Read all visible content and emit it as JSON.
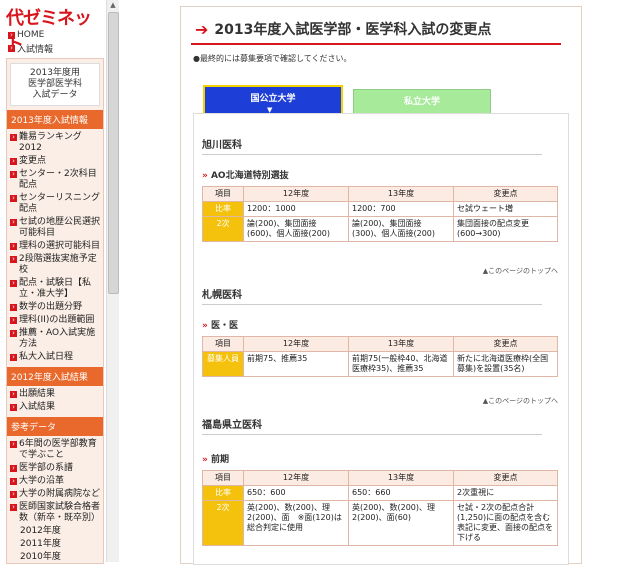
{
  "logo": "代ゼミネット",
  "toplinks": [
    "HOME",
    "入試情報"
  ],
  "sidebox_title": [
    "2013年度用",
    "医学部医学科",
    "入試データ"
  ],
  "sec1": "2013年度入試情報",
  "sec1_items": [
    "難易ランキング2012",
    "変更点",
    "センター・2次科目配点",
    "センターリスニング配点",
    "セ試の地歴公民選択可能科目",
    "理科の選択可能科目",
    "2段階選抜実施予定校",
    "配点・試験日【私立・准大学】",
    "数学の出題分野",
    "理科(II)の出題範囲",
    "推薦・AO入試実施方法",
    "私大入試日程"
  ],
  "sec2": "2012年度入試結果",
  "sec2_items": [
    "出願結果",
    "入試結果"
  ],
  "sec3": "参考データ",
  "sec3_items": [
    "6年間の医学部教育で学ぶこと",
    "医学部の系譜",
    "大学の沿革",
    "大学の附属病院など",
    "医師国家試験合格者数（新卒・既卒別）"
  ],
  "sec3_sub": [
    "2012年度",
    "2011年度",
    "2010年度"
  ],
  "main": {
    "title": "2013年度入試医学部・医学科入試の変更点",
    "note": "●最終的には募集要項で確認してください。",
    "tab_national": "国公立大学",
    "tab_private": "私立大学",
    "back_to_top": "▲このページのトップへ"
  },
  "col_headers": [
    "項目",
    "12年度",
    "13年度",
    "変更点"
  ],
  "sections": [
    {
      "university": "旭川医科",
      "level": "AO北海道特別選抜",
      "rows": [
        {
          "label": "比率",
          "y12": "1200：1000",
          "y13": "1200：700",
          "change": "セ試ウェート増"
        },
        {
          "label": "2次",
          "y12": "論(200)、集団面接(600)、個人面接(200)",
          "y13": "論(200)、集団面接(300)、個人面接(200)",
          "change": "集団面接の配点変更(600→300)"
        }
      ]
    },
    {
      "university": "札幌医科",
      "level": "医・医",
      "rows": [
        {
          "label": "募集人員",
          "y12": "前期75、推薦35",
          "y13": "前期75(一般枠40、北海道医療枠35)、推薦35",
          "change": "新たに北海道医療枠(全国募集)を設置(35名)"
        }
      ]
    },
    {
      "university": "福島県立医科",
      "level": "前期",
      "rows": [
        {
          "label": "比率",
          "y12": "650：600",
          "y13": "650：660",
          "change": "2次重視に"
        },
        {
          "label": "2次",
          "y12": "英(200)、数(200)、理2(200)、面　※面(120)は総合判定に使用",
          "y13": "英(200)、数(200)、理2(200)、面(60)",
          "change": "セ試・2次の配点合計(1,250)に面の配点を含む表記に変更、面接の配点を下げる"
        }
      ]
    }
  ]
}
